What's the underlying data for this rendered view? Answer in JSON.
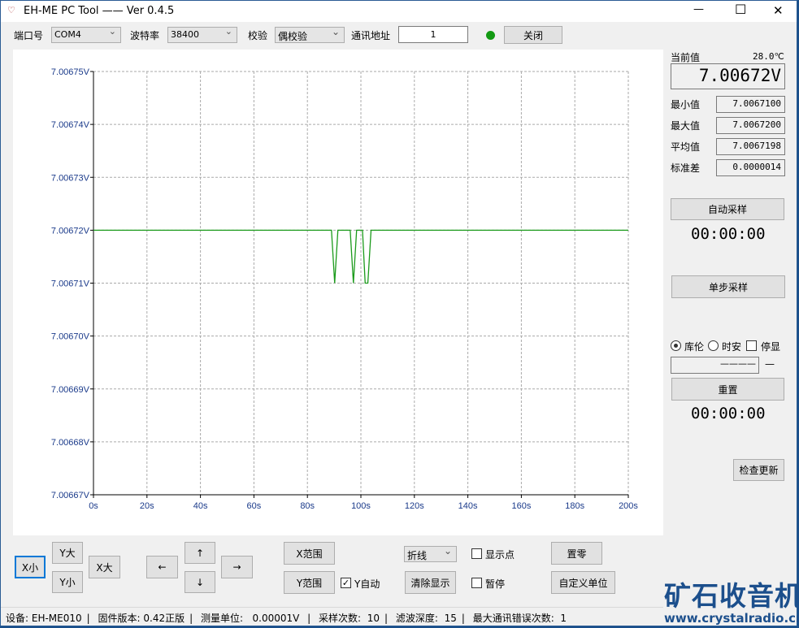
{
  "window": {
    "title": "EH-ME PC Tool  ——  Ver 0.4.5",
    "minimize": "—",
    "maximize": "☐",
    "close": "✕"
  },
  "toolbar": {
    "port_label": "端口号",
    "port_value": "COM4",
    "baud_label": "波特率",
    "baud_value": "38400",
    "parity_label": "校验",
    "parity_value": "偶校验",
    "addr_label": "通讯地址",
    "addr_value": "1",
    "status_color": "#139a13",
    "close_button": "关闭"
  },
  "panel": {
    "current_label": "当前值",
    "temperature": "28.0℃",
    "current_value": "7.00672V",
    "stats": [
      {
        "label": "最小值",
        "value": "7.0067100"
      },
      {
        "label": "最大值",
        "value": "7.0067200"
      },
      {
        "label": "平均值",
        "value": "7.0067198"
      },
      {
        "label": "标准差",
        "value": "0.0000014"
      }
    ],
    "auto_sample": "自动采样",
    "auto_timer": "00:00:00",
    "single_sample": "单步采样",
    "radio_coulomb": "库伦",
    "radio_ah": "时安",
    "stop_display": "停显",
    "coulomb_value": "————",
    "unit_value": "—",
    "reset": "重置",
    "reset_timer": "00:00:00",
    "check_update": "检查更新"
  },
  "controls": {
    "x_small": "X小",
    "y_big": "Y大",
    "x_big": "X大",
    "y_small": "Y小",
    "left": "←",
    "up": "↑",
    "right": "→",
    "down": "↓",
    "x_range": "X范围",
    "y_range": "Y范围",
    "y_auto": "Y自动",
    "y_auto_checked": true,
    "mode": "折线",
    "clear": "清除显示",
    "show_points": "显示点",
    "pause": "暂停",
    "zero": "置零",
    "custom_unit": "自定义单位"
  },
  "status": {
    "device_label": "设备:",
    "device": "EH-ME010",
    "fw_label": "固件版本:",
    "fw": "0.42正版",
    "unit_label": "测量单位:",
    "unit": "0.00001V",
    "samples_label": "采样次数:",
    "samples": "10",
    "filter_label": "滤波深度:",
    "filter": "15",
    "err_label": "最大通讯错误次数:",
    "err": "1"
  },
  "logo": {
    "text": "矿石收音机",
    "url": "www.crystalradio.cn",
    "color": "#1c4f8c"
  },
  "chart_data": {
    "type": "line",
    "xlim": [
      0,
      200
    ],
    "ylim": [
      7.00667,
      7.00675
    ],
    "grid": true,
    "line_color": "#1a9a1a",
    "x_ticks": [
      "0s",
      "20s",
      "40s",
      "60s",
      "80s",
      "100s",
      "120s",
      "140s",
      "160s",
      "180s",
      "200s"
    ],
    "y_ticks": [
      "7.00675V",
      "7.00674V",
      "7.00673V",
      "7.00672V",
      "7.00671V",
      "7.00670V",
      "7.00669V",
      "7.00668V",
      "7.00667V"
    ],
    "x": [
      0,
      89,
      90.2,
      91.4,
      96,
      97.2,
      98.4,
      100.6,
      101.6,
      102.6,
      103.8,
      200
    ],
    "y": [
      7.00672,
      7.00672,
      7.00671,
      7.00672,
      7.00672,
      7.00671,
      7.00672,
      7.00672,
      7.00671,
      7.00671,
      7.00672,
      7.00672
    ]
  }
}
